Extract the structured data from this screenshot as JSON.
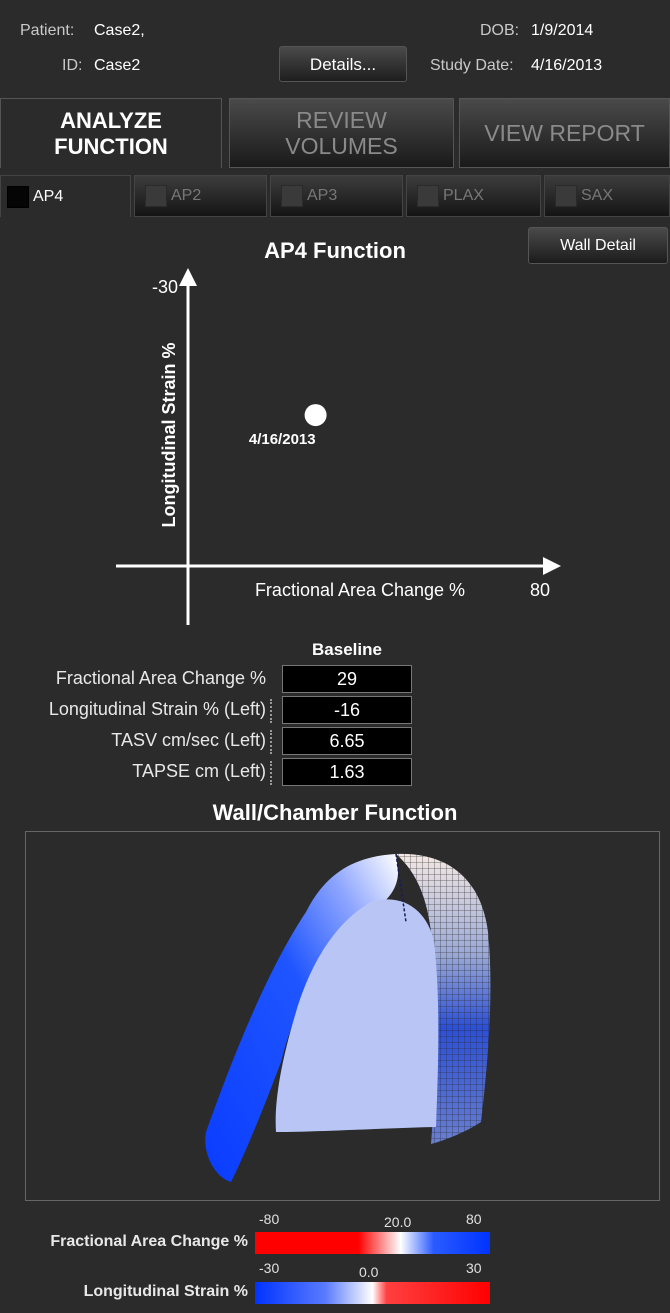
{
  "header": {
    "patient_label": "Patient:",
    "patient_value": "Case2,",
    "id_label": "ID:",
    "id_value": "Case2",
    "dob_label": "DOB:",
    "dob_value": "1/9/2014",
    "study_label": "Study Date:",
    "study_value": "4/16/2013",
    "details_button": "Details..."
  },
  "main_tabs": [
    {
      "line1": "ANALYZE",
      "line2": "FUNCTION",
      "active": true
    },
    {
      "line1": "REVIEW",
      "line2": "VOLUMES",
      "active": false
    },
    {
      "line1": "VIEW REPORT",
      "line2": "",
      "active": false
    }
  ],
  "view_tabs": [
    {
      "label": "AP4",
      "active": true
    },
    {
      "label": "AP2",
      "active": false
    },
    {
      "label": "AP3",
      "active": false
    },
    {
      "label": "PLAX",
      "active": false
    },
    {
      "label": "SAX",
      "active": false
    }
  ],
  "wall_detail_button": "Wall Detail",
  "chart_data": {
    "type": "scatter",
    "title": "AP4 Function",
    "xlabel": "Fractional Area Change %",
    "ylabel": "Longitudinal Strain %",
    "xlim": [
      0,
      80
    ],
    "ylim": [
      0,
      -30
    ],
    "x_max_label": "80",
    "y_max_label": "-30",
    "points": [
      {
        "x": 29,
        "y": -16,
        "label": "4/16/2013"
      }
    ]
  },
  "metrics": {
    "column_header": "Baseline",
    "rows": [
      {
        "label": "Fractional Area Change %",
        "value": "29"
      },
      {
        "label": "Longitudinal Strain % (Left)",
        "value": "-16"
      },
      {
        "label": "TASV cm/sec (Left)",
        "value": "6.65"
      },
      {
        "label": "TAPSE cm (Left)",
        "value": "1.63"
      }
    ]
  },
  "wall_chamber": {
    "title": "Wall/Chamber Function"
  },
  "legends": [
    {
      "label": "Fractional Area Change %",
      "min": "-80",
      "mid": "20.0",
      "max": "80"
    },
    {
      "label": "Longitudinal Strain %",
      "min": "-30",
      "mid": "0.0",
      "max": "30"
    }
  ],
  "colors": {
    "background": "#2b2b2b",
    "scale_red": "#ff0000",
    "scale_blue": "#0033ff",
    "chamber_fill": "#b9c6f5"
  }
}
